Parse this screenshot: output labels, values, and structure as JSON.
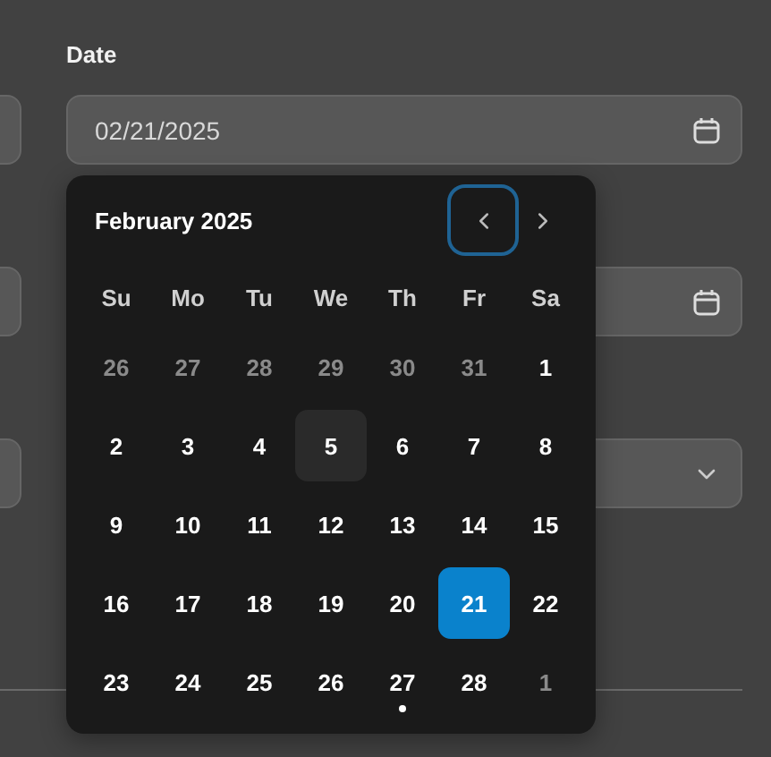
{
  "form": {
    "date_label": "Date",
    "date_value": "02/21/2025"
  },
  "calendar": {
    "month_title": "February 2025",
    "nav": [
      {
        "kind": "prev",
        "focused": true
      },
      {
        "kind": "next",
        "focused": false
      }
    ],
    "weekdays": [
      "Su",
      "Mo",
      "Tu",
      "We",
      "Th",
      "Fr",
      "Sa"
    ],
    "days": [
      {
        "label": "26",
        "outside": true,
        "selected": false,
        "hovered": false,
        "today": false
      },
      {
        "label": "27",
        "outside": true,
        "selected": false,
        "hovered": false,
        "today": false
      },
      {
        "label": "28",
        "outside": true,
        "selected": false,
        "hovered": false,
        "today": false
      },
      {
        "label": "29",
        "outside": true,
        "selected": false,
        "hovered": false,
        "today": false
      },
      {
        "label": "30",
        "outside": true,
        "selected": false,
        "hovered": false,
        "today": false
      },
      {
        "label": "31",
        "outside": true,
        "selected": false,
        "hovered": false,
        "today": false
      },
      {
        "label": "1",
        "outside": false,
        "selected": false,
        "hovered": false,
        "today": false
      },
      {
        "label": "2",
        "outside": false,
        "selected": false,
        "hovered": false,
        "today": false
      },
      {
        "label": "3",
        "outside": false,
        "selected": false,
        "hovered": false,
        "today": false
      },
      {
        "label": "4",
        "outside": false,
        "selected": false,
        "hovered": false,
        "today": false
      },
      {
        "label": "5",
        "outside": false,
        "selected": false,
        "hovered": true,
        "today": false
      },
      {
        "label": "6",
        "outside": false,
        "selected": false,
        "hovered": false,
        "today": false
      },
      {
        "label": "7",
        "outside": false,
        "selected": false,
        "hovered": false,
        "today": false
      },
      {
        "label": "8",
        "outside": false,
        "selected": false,
        "hovered": false,
        "today": false
      },
      {
        "label": "9",
        "outside": false,
        "selected": false,
        "hovered": false,
        "today": false
      },
      {
        "label": "10",
        "outside": false,
        "selected": false,
        "hovered": false,
        "today": false
      },
      {
        "label": "11",
        "outside": false,
        "selected": false,
        "hovered": false,
        "today": false
      },
      {
        "label": "12",
        "outside": false,
        "selected": false,
        "hovered": false,
        "today": false
      },
      {
        "label": "13",
        "outside": false,
        "selected": false,
        "hovered": false,
        "today": false
      },
      {
        "label": "14",
        "outside": false,
        "selected": false,
        "hovered": false,
        "today": false
      },
      {
        "label": "15",
        "outside": false,
        "selected": false,
        "hovered": false,
        "today": false
      },
      {
        "label": "16",
        "outside": false,
        "selected": false,
        "hovered": false,
        "today": false
      },
      {
        "label": "17",
        "outside": false,
        "selected": false,
        "hovered": false,
        "today": false
      },
      {
        "label": "18",
        "outside": false,
        "selected": false,
        "hovered": false,
        "today": false
      },
      {
        "label": "19",
        "outside": false,
        "selected": false,
        "hovered": false,
        "today": false
      },
      {
        "label": "20",
        "outside": false,
        "selected": false,
        "hovered": false,
        "today": false
      },
      {
        "label": "21",
        "outside": false,
        "selected": true,
        "hovered": false,
        "today": false
      },
      {
        "label": "22",
        "outside": false,
        "selected": false,
        "hovered": false,
        "today": false
      },
      {
        "label": "23",
        "outside": false,
        "selected": false,
        "hovered": false,
        "today": false
      },
      {
        "label": "24",
        "outside": false,
        "selected": false,
        "hovered": false,
        "today": false
      },
      {
        "label": "25",
        "outside": false,
        "selected": false,
        "hovered": false,
        "today": false
      },
      {
        "label": "26",
        "outside": false,
        "selected": false,
        "hovered": false,
        "today": false
      },
      {
        "label": "27",
        "outside": false,
        "selected": false,
        "hovered": false,
        "today": true
      },
      {
        "label": "28",
        "outside": false,
        "selected": false,
        "hovered": false,
        "today": false
      },
      {
        "label": "1",
        "outside": true,
        "selected": false,
        "hovered": false,
        "today": false
      }
    ]
  }
}
